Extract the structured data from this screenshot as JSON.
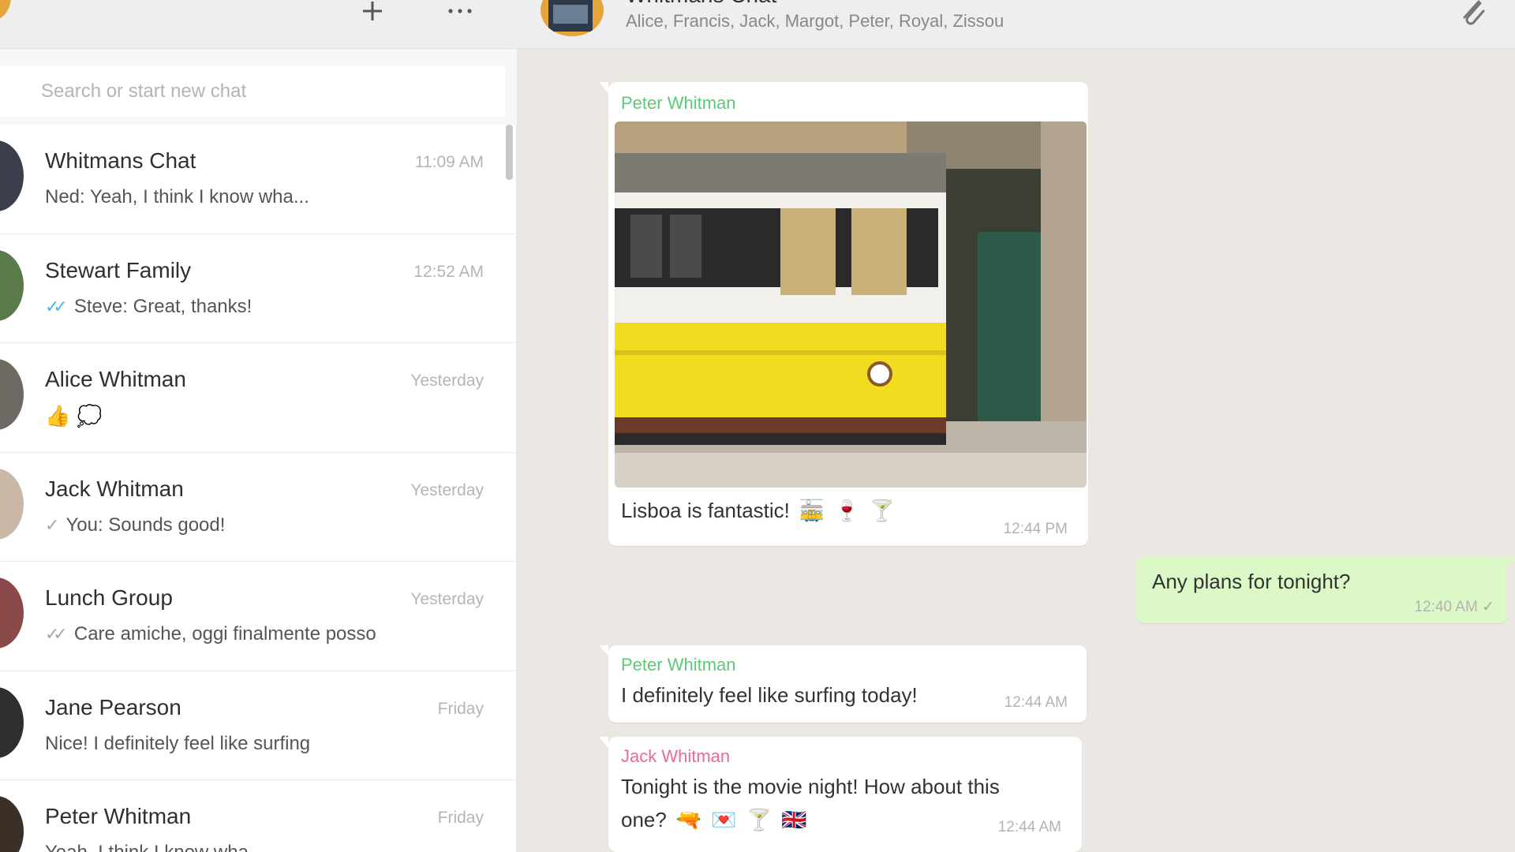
{
  "sidebar": {
    "search_placeholder": "Search or start new chat",
    "new_chat_icon": "plus-icon",
    "menu_icon": "ellipsis-icon",
    "chats": [
      {
        "name": "Whitmans Chat",
        "time": "11:09 AM",
        "preview": "Ned: Yeah, I think I know wha...",
        "status": "none",
        "avatar_color": "#3b3f4c"
      },
      {
        "name": "Stewart Family",
        "time": "12:52 AM",
        "preview": "Steve: Great, thanks!",
        "status": "read",
        "avatar_color": "#5b7a4a"
      },
      {
        "name": "Alice Whitman",
        "time": "Yesterday",
        "preview": "",
        "status": "none",
        "emojis": [
          "👍",
          "💭"
        ],
        "avatar_color": "#6d6a64"
      },
      {
        "name": "Jack Whitman",
        "time": "Yesterday",
        "preview": "You: Sounds good!",
        "status": "sent",
        "avatar_color": "#c9b8a8"
      },
      {
        "name": "Lunch Group",
        "time": "Yesterday",
        "preview": "Care amiche, oggi finalmente posso",
        "status": "delivered",
        "avatar_color": "#8a4a4a"
      },
      {
        "name": "Jane Pearson",
        "time": "Friday",
        "preview": "Nice! I definitely feel like surfing",
        "status": "none",
        "avatar_color": "#2f2f2f"
      },
      {
        "name": "Peter Whitman",
        "time": "Friday",
        "preview": "Yeah, I think I know wha...",
        "status": "none",
        "avatar_color": "#3a3028"
      }
    ]
  },
  "chat": {
    "title": "Whitmans Chat",
    "members": "Alice, Francis, Jack, Margot, Peter, Royal, Zissou",
    "attach_icon": "paperclip-icon",
    "messages": [
      {
        "sender": "Peter Whitman",
        "sender_color": "#5dc978",
        "text": "Lisboa is fantastic!",
        "emojis": [
          "🚋",
          "🍷",
          "🍸"
        ],
        "time": "12:44 PM",
        "direction": "in",
        "has_image": true,
        "image_subject": "yellow-tram-photo"
      },
      {
        "text": "Any plans for tonight?",
        "time": "12:40 AM",
        "direction": "out",
        "status": "sent"
      },
      {
        "sender": "Peter Whitman",
        "sender_color": "#5dc978",
        "text": "I definitely feel like surfing today!",
        "time": "12:44 AM",
        "direction": "in"
      },
      {
        "sender": "Jack Whitman",
        "sender_color": "#e96c8f",
        "text": "Tonight is the movie night! How about this",
        "text2": "one?",
        "emojis": [
          "🔫",
          "💌",
          "🍸",
          "🇬🇧"
        ],
        "time": "12:44 AM",
        "direction": "in"
      }
    ]
  },
  "colors": {
    "chat_bg": "#ebe7e2",
    "outgoing_bubble": "#dcf8c6",
    "read_tick": "#4fb5e6"
  }
}
